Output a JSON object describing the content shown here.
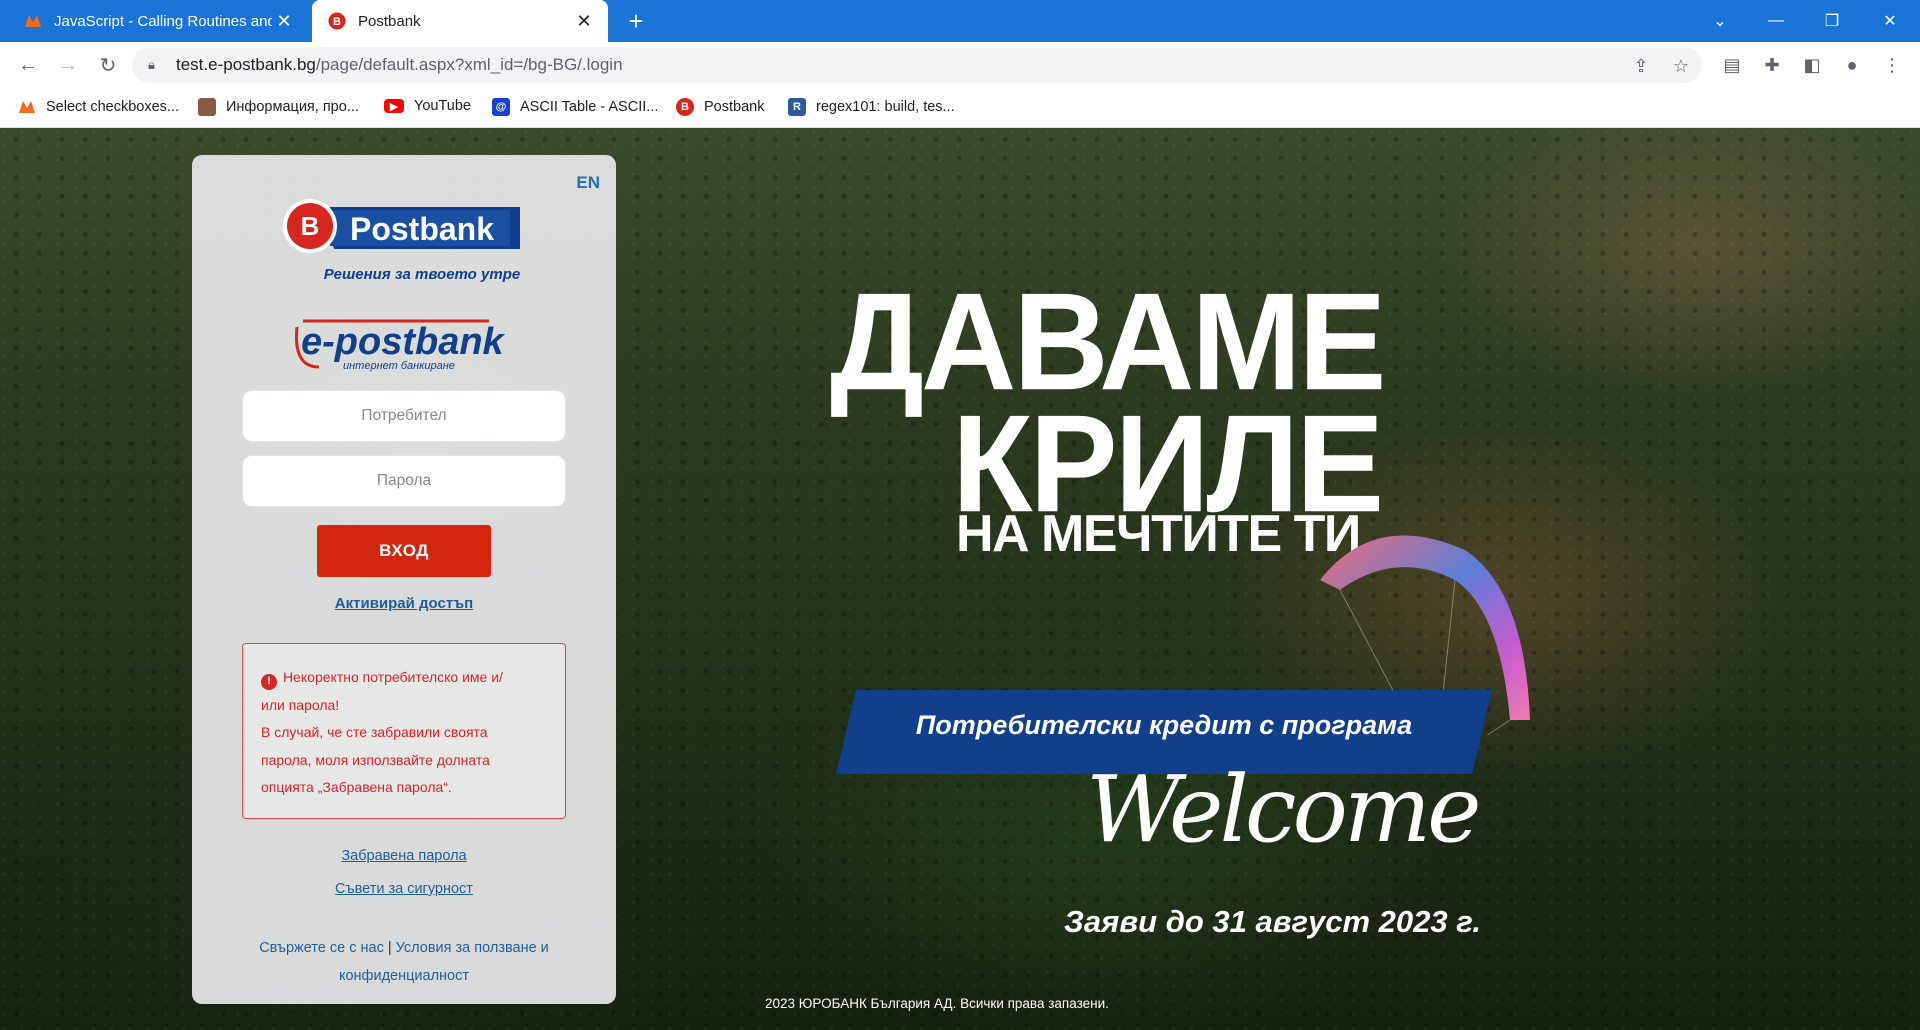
{
  "browser": {
    "tabs": [
      {
        "title": "JavaScript - Calling Routines and",
        "active": false,
        "icon": "postman-icon"
      },
      {
        "title": "Postbank",
        "active": true,
        "icon": "postbank-icon"
      }
    ],
    "url_host": "test.e-postbank.bg",
    "url_path": "/page/default.aspx?xml_id=/bg-BG/.login",
    "bookmarks": [
      {
        "label": "Select checkboxes...",
        "icon": "postman-icon",
        "color": "#ef6c22"
      },
      {
        "label": "Информация, про...",
        "icon": "photo-icon",
        "color": "#8a5a44"
      },
      {
        "label": "YouTube",
        "icon": "youtube-icon",
        "color": "#ff0000"
      },
      {
        "label": "ASCII Table - ASCII...",
        "icon": "at-icon",
        "color": "#1a3fd6"
      },
      {
        "label": "Postbank",
        "icon": "postbank-icon",
        "color": "#d7261e"
      },
      {
        "label": "regex101: build, tes...",
        "icon": "regex-icon",
        "color": "#2d5a9b"
      }
    ]
  },
  "login": {
    "lang": "EN",
    "brand": "Postbank",
    "slogan": "Решения за твоето утре",
    "epb_name": "e-postbank",
    "epb_sub": "интернет банкиране",
    "username_placeholder": "Потребител",
    "password_placeholder": "Парола",
    "submit": "ВХОД",
    "activate": "Активирай достъп",
    "error_line1": "Некоректно потребителско име и/",
    "error_line2": "или парола!",
    "error_line3": "В случай, че сте забравили своята",
    "error_line4": "парола, моля използвайте долната",
    "error_line5": "опцията „Забравена парола“.",
    "forgot": "Забравена парола",
    "security": "Съвети за сигурност",
    "contact": "Свържете се с нас",
    "separator": "|",
    "terms": "Условия за ползване и конфиденциалност"
  },
  "hero": {
    "line1": "ДАВАМЕ",
    "line2": "КРИЛЕ",
    "line3": "НА МЕЧТИТЕ ТИ",
    "banner": "Потребителски кредит с програма",
    "welcome": "Welcome",
    "apply": "Заяви до 31 август 2023 г."
  },
  "footer": {
    "copyright": "2023 ЮРОБАНК България АД. Всички права запазени."
  },
  "colors": {
    "chrome_blue": "#1a73d7",
    "postbank_red": "#d4260e",
    "link_blue": "#1f5f97",
    "banner_blue": "#113f8c",
    "error_red": "#d8232a"
  }
}
